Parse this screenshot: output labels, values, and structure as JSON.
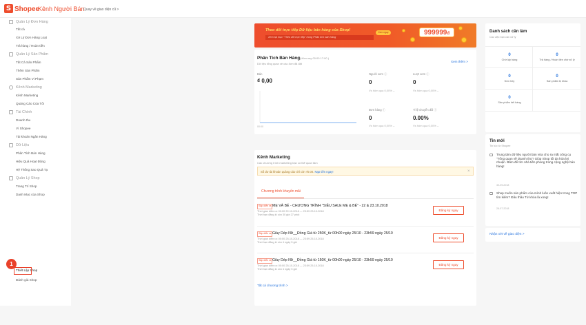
{
  "header": {
    "logo_glyph": "S",
    "brand": "Shopee",
    "subtitle": "Kênh Người Bán",
    "old_ui_link": "Quay về giao diện cũ >"
  },
  "sidebar": {
    "groups": [
      {
        "icon": "order-icon",
        "label": "Quản Lý Đơn Hàng",
        "items": [
          "Tất cả",
          "Xử Lý Đơn Hàng Loạt",
          "Trả hàng / Hoàn tiền"
        ]
      },
      {
        "icon": "product-icon",
        "label": "Quản Lý Sản Phẩm",
        "items": [
          "Tất Cả Sản Phẩm",
          "Thêm Sản Phẩm",
          "Sản Phẩm Vi Phạm"
        ]
      },
      {
        "icon": "marketing-icon",
        "label": "Kênh Marketing",
        "items": [
          "Kênh Marketing",
          "Quảng Cáo Của Tôi"
        ]
      },
      {
        "icon": "finance-icon",
        "label": "Tài Chính",
        "items": [
          "Doanh thu",
          "Ví Shopee",
          "Tài khoản Ngân Hàng"
        ]
      },
      {
        "icon": "data-icon",
        "label": "Dữ Liệu",
        "items": [
          "Phân Tích Bán Hàng",
          "Hiệu Quả Hoạt Động",
          "Hệ Thống Sao Quả Tạ"
        ]
      },
      {
        "icon": "shop-icon",
        "label": "Quản Lý Shop",
        "items": [
          "Trang Trí Shop",
          "Danh Mục của Shop",
          "Thiết Lập Shop",
          "Đánh giá Shop"
        ]
      }
    ],
    "step_badge": "1"
  },
  "banner": {
    "line1": "Theo dõi trực tiếp Dữ liệu bán hàng của Shop!",
    "line2": "Xem tại mục \"Theo dõi trực tiếp\" trong Phân tích bán hàng",
    "button": "Xem ngay",
    "number": "999999",
    "number_suffix": "đ"
  },
  "analysis": {
    "title": "Phân Tích Bán Hàng",
    "updated": "(Hôm nay 00:00 17:00 )",
    "subtitle": "Dữ liệu tổng quan về các đơn đã đặt",
    "more": "Xem thêm >",
    "sales_label": "Bán",
    "sales_value": "₫ 0,00",
    "chart_time": "00:00",
    "metrics": [
      {
        "label": "Người xem ⓘ",
        "value": "0",
        "compare": "Vs hôm qua 0,00% --"
      },
      {
        "label": "Lượt xem ⓘ",
        "value": "0",
        "compare": "Vs hôm qua 0,00% --"
      },
      {
        "label": "Đơn hàng ⓘ",
        "value": "0",
        "compare": "Vs hôm qua 0,00% --"
      },
      {
        "label": "Tỉ lệ chuyển đổi ⓘ",
        "value": "0.00%",
        "compare": "Vs hôm qua 0,00% --"
      }
    ]
  },
  "marketing": {
    "title": "Kênh Marketing",
    "subtitle": "Các chương trình marketing bạn có thể quan tâm",
    "notice": "Số dư tài khoản quảng cáo chỉ còn ₫0.00.",
    "notice_link": "Nạp tiền ngay!",
    "close": "×",
    "tab": "Chương trình khuyến mãi",
    "programs": [
      {
        "tag": "Sắp diễn ra",
        "title": "MẸ VÀ BÉ - CHƯƠNG TRÌNH \"SIÊU SALE MẸ & BÉ\" - 22 & 23.10.2018",
        "time": "Thời gian diễn ra: 00:00 22-10-2018 — 23:59 23-10-2018",
        "deadline": "Thời hạn đăng kí còn 30 giờ 27 phút",
        "button": "Đăng ký ngay"
      },
      {
        "tag": "Sắp diễn ra",
        "title": "Giày Dép Nữ__Đồng Giá từ 250K_từ 00h00 ngày 25/10 - 23h59 ngày 25/10",
        "time": "Thời gian diễn ra: 00:00 25-10-2018 — 23:59 25-10-2018",
        "deadline": "Thời hạn đăng kí còn 4 ngày 5 giờ",
        "button": "Đăng ký ngay"
      },
      {
        "tag": "Sắp diễn ra",
        "title": "Giày Dép Nữ__Đồng Giá từ 150K_từ 00h00 ngày 25/10 - 23h59 ngày 25/10",
        "time": "Thời gian diễn ra: 00:00 25-10-2018 — 23:59 25-10-2018",
        "deadline": "Thời hạn đăng kí còn 4 ngày 5 giờ",
        "button": "Đăng ký ngay"
      }
    ],
    "all_link": "Tất cả chương trình >"
  },
  "todo": {
    "title": "Danh sách cần làm",
    "subtitle": "Các việc bạn cần xử lý",
    "cells": [
      {
        "n": "0",
        "label": "Chờ lấy hàng"
      },
      {
        "n": "0",
        "label": "Trả hàng / Hoàn tiền chờ xử lý"
      },
      {
        "n": "0",
        "label": "Đơn hủy"
      },
      {
        "n": "0",
        "label": "Sản phẩm bị khóa"
      },
      {
        "n": "0",
        "label": "Sản phẩm hết hàng"
      }
    ]
  },
  "news": {
    "title": "Tin mới",
    "subtitle": "Tin tức từ Shopee",
    "items": [
      {
        "text": "Trung tâm dữ liệu người bán vừa cho ra mắt công cụ \"Tổng quan về doanh thu\"! Giúp Shop tối đa hóa lợi nhuận. Bấm để tìm nhà tiền phong trong cộng nghệ bán hàng!",
        "date": "30-09-2018"
      },
      {
        "text": "Shop muốn sản phẩm của mình luôn xuất hiện trong TOP tìm kiếm? Đấu thầu Từ khóa là xong!",
        "date": "26-07-2018"
      }
    ]
  },
  "feedback": {
    "label": "Nhận xét về giao diện >"
  },
  "colors": {
    "brand": "#ee4d2d",
    "link": "#2673dd",
    "chart_line": "#7fb2f0"
  }
}
